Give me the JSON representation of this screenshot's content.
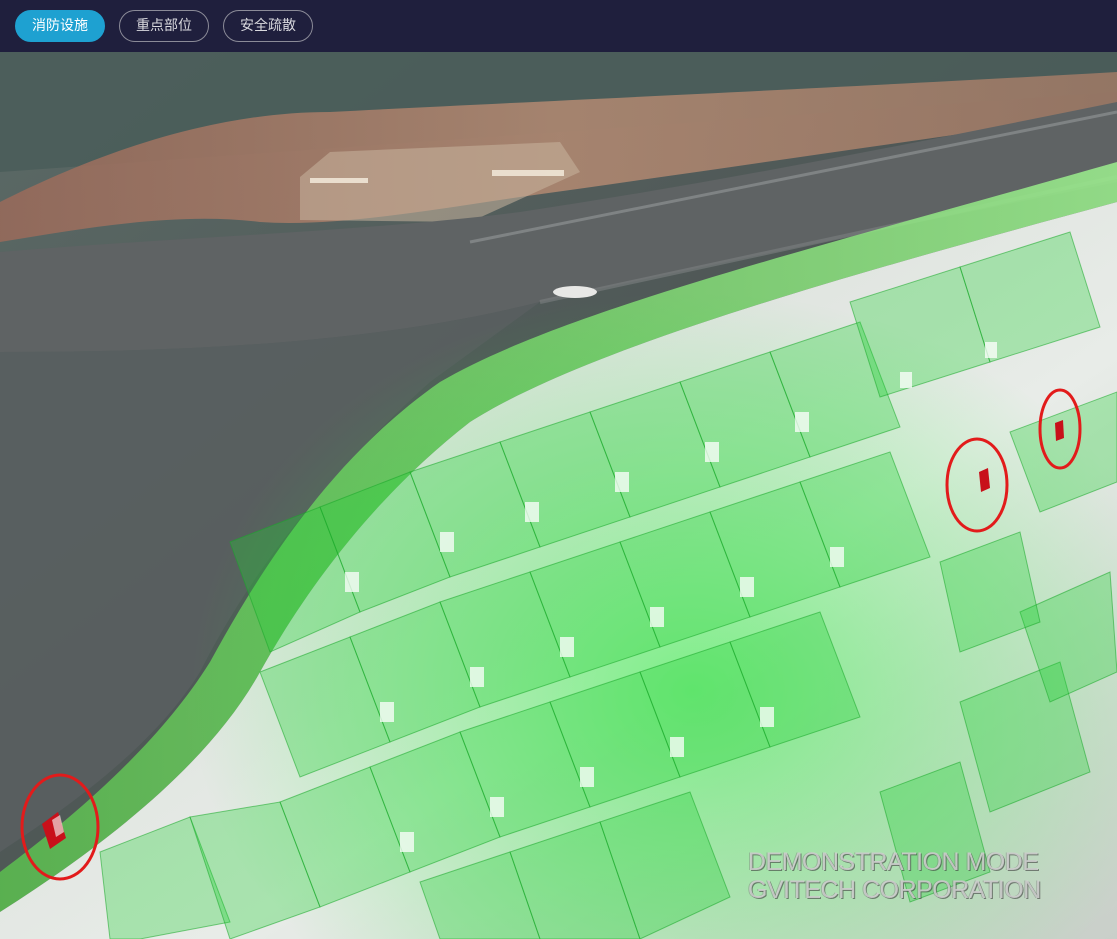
{
  "toolbar": {
    "tabs": [
      {
        "label": "消防设施",
        "active": true
      },
      {
        "label": "重点部位",
        "active": false
      },
      {
        "label": "安全疏散",
        "active": false
      }
    ]
  },
  "scene": {
    "markers": [
      {
        "name": "fire-extinguisher-marker-1",
        "icon": "fire-extinguisher-icon"
      },
      {
        "name": "fire-extinguisher-marker-2",
        "icon": "fire-extinguisher-icon"
      },
      {
        "name": "fire-extinguisher-marker-3",
        "icon": "fire-extinguisher-icon"
      }
    ],
    "marker_color": "#e21b1b",
    "building_color": "#22dd33"
  },
  "watermark": {
    "line1": "DEMONSTRATION MODE",
    "line2": "GVITECH CORPORATION"
  }
}
